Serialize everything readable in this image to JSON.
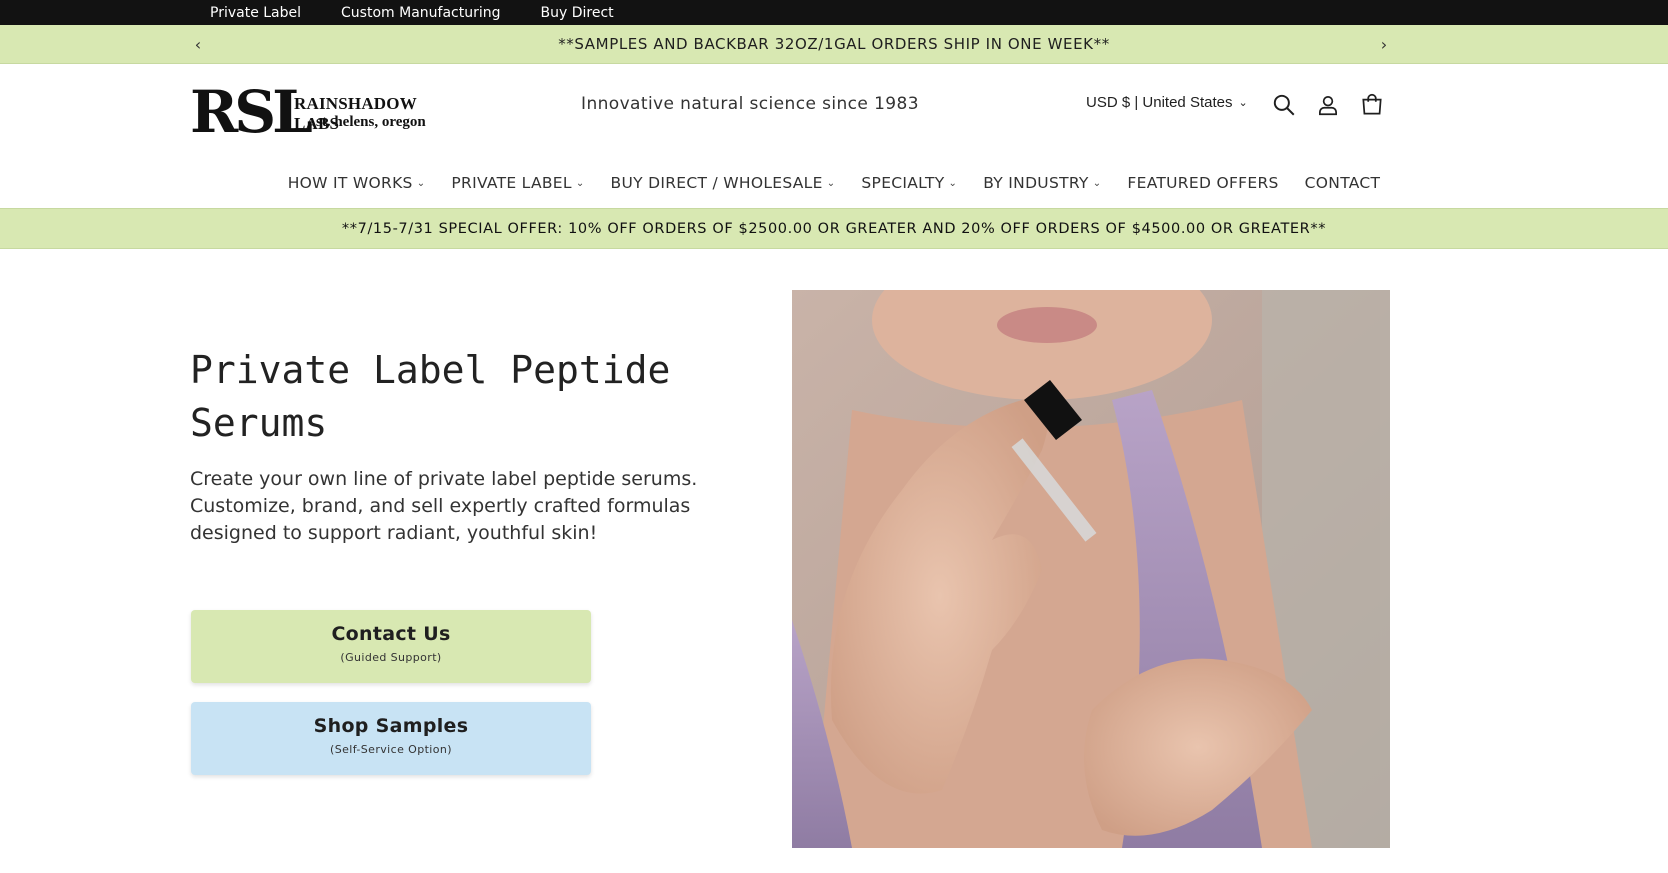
{
  "utility_bar": {
    "links": [
      "Private Label",
      "Custom Manufacturing",
      "Buy Direct"
    ]
  },
  "announcement": {
    "text": "**SAMPLES AND BACKBAR 32OZ/1GAL ORDERS SHIP IN ONE WEEK**",
    "prev_icon": "chevron-left-icon",
    "next_icon": "chevron-right-icon"
  },
  "header": {
    "logo": {
      "mark": "RSL",
      "name": "RAINSHADOW LABS",
      "location": "st. helens, oregon"
    },
    "tagline": "Innovative natural science since 1983",
    "country_selector": "USD $ | United States",
    "icons": [
      "search-icon",
      "account-icon",
      "cart-icon"
    ]
  },
  "nav": {
    "items": [
      {
        "label": "HOW IT WORKS",
        "dropdown": true
      },
      {
        "label": "PRIVATE LABEL",
        "dropdown": true
      },
      {
        "label": "BUY DIRECT / WHOLESALE",
        "dropdown": true
      },
      {
        "label": "SPECIALTY",
        "dropdown": true
      },
      {
        "label": "BY INDUSTRY",
        "dropdown": true
      },
      {
        "label": "FEATURED OFFERS",
        "dropdown": false
      },
      {
        "label": "CONTACT",
        "dropdown": false
      }
    ]
  },
  "offer": {
    "text": "**7/15-7/31 SPECIAL OFFER: 10% OFF ORDERS OF $2500.00 OR GREATER AND 20% OFF ORDERS OF $4500.00 OR GREATER**"
  },
  "hero": {
    "title_line1": "Private Label Peptide",
    "title_line2": "Serums",
    "description_line1": "Create your own line of private label peptide serums.",
    "description_line2": "Customize, brand, and sell expertly crafted formulas",
    "description_line3": "designed to support radiant, youthful skin!",
    "contact": {
      "label": "Contact Us",
      "sublabel": "(Guided Support)"
    },
    "samples": {
      "label": "Shop Samples",
      "sublabel": "(Self-Service Option)"
    }
  },
  "colors": {
    "utility_bar": "#121212",
    "announcement_bg": "#d8e8b2",
    "contact_button": "#d8e8b2",
    "samples_button": "#c8e3f4"
  }
}
